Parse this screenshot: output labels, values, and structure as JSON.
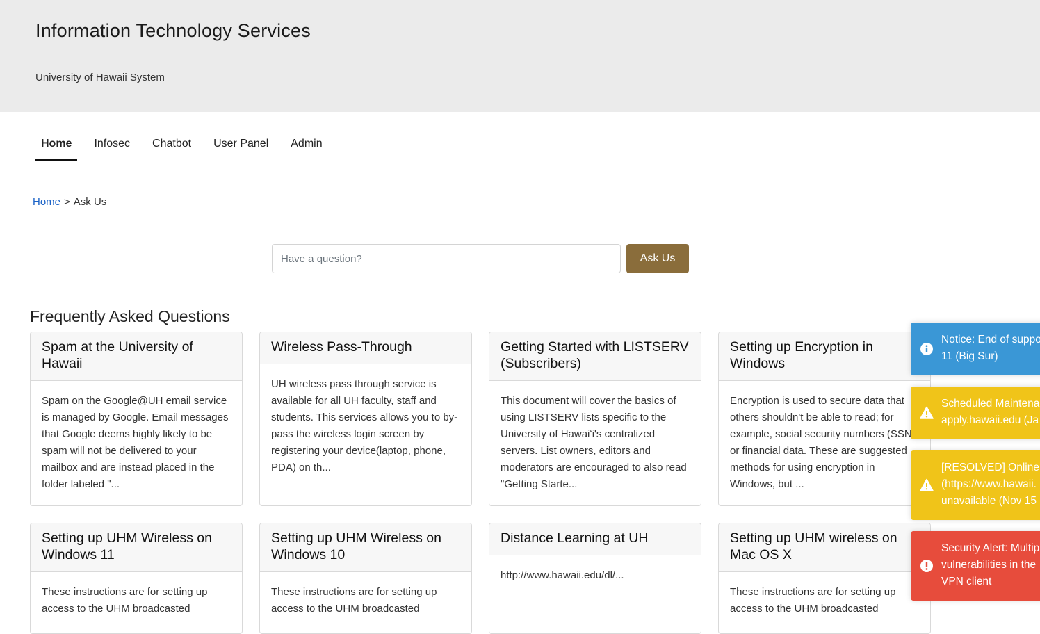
{
  "header": {
    "title": "Information Technology Services",
    "subtitle": "University of Hawaii System"
  },
  "nav": {
    "items": [
      {
        "label": "Home"
      },
      {
        "label": "Infosec"
      },
      {
        "label": "Chatbot"
      },
      {
        "label": "User Panel"
      },
      {
        "label": "Admin"
      }
    ],
    "active": "Home"
  },
  "breadcrumb": {
    "home": "Home",
    "separator": ">",
    "current": "Ask Us"
  },
  "search": {
    "placeholder": "Have a question?",
    "value": "",
    "button_label": "Ask Us"
  },
  "faq": {
    "heading": "Frequently Asked Questions",
    "cards": [
      {
        "title": "Spam at the University of Hawaii",
        "body": "Spam on the Google@UH email service is managed by Google. Email messages that Google deems highly likely to be spam will not be delivered to your mailbox and are instead placed in the folder labeled \"..."
      },
      {
        "title": "Wireless Pass-Through",
        "body": "UH wireless pass through service is available for all UH faculty, staff and students. This services allows you to by-pass the wireless login screen by registering your device(laptop, phone, PDA) on th..."
      },
      {
        "title": "Getting Started with LISTSERV (Subscribers)",
        "body": "This document will cover the basics of using LISTSERV lists specific to the University of Hawaiʻi's centralized servers. List owners, editors and moderators are encouraged to also read \"Getting Starte..."
      },
      {
        "title": "Setting up Encryption in Windows",
        "body": "Encryption is used to secure data that others shouldn't be able to read; for example, social security numbers (SSN) or financial data. These are suggested methods for using encryption in Windows, but ..."
      },
      {
        "title": "Setting up UHM Wireless on Windows 11",
        "body": "These instructions are for setting up access to the UHM broadcasted"
      },
      {
        "title": "Setting up UHM Wireless on Windows 10",
        "body": "These instructions are for setting up access to the UHM broadcasted"
      },
      {
        "title": "Distance Learning at UH",
        "body": "http://www.hawaii.edu/dl/..."
      },
      {
        "title": "Setting up UHM wireless on Mac OS X",
        "body": "These instructions are for setting up access to the UHM broadcasted"
      }
    ]
  },
  "notifications": [
    {
      "type": "info",
      "icon": "info-circle-icon",
      "color": "#3a97d6",
      "lines": [
        "Notice: End of suppo",
        "11 (Big Sur)"
      ]
    },
    {
      "type": "warning",
      "icon": "warning-triangle-icon",
      "color": "#f0c419",
      "lines": [
        "Scheduled Maintena",
        "apply.hawaii.edu (Ja"
      ]
    },
    {
      "type": "warning",
      "icon": "warning-triangle-icon",
      "color": "#f0c419",
      "lines": [
        "[RESOLVED] Online",
        "(https://www.hawaii.",
        "unavailable (Nov 15"
      ]
    },
    {
      "type": "error",
      "icon": "error-circle-icon",
      "color": "#e74c3c",
      "lines": [
        "Security Alert: Multip",
        "vulnerabilities in the",
        "VPN client"
      ]
    }
  ],
  "colors": {
    "header_bg": "#ebebeb",
    "accent_button": "#8a6d3b",
    "link": "#1a62c7"
  }
}
